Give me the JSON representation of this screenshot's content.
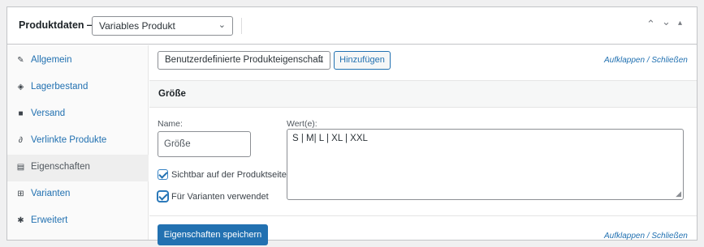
{
  "header": {
    "title": "Produktdaten —",
    "product_type": "Variables Produkt",
    "controls": [
      "⌃",
      "⌄",
      "▴"
    ]
  },
  "sidebar": {
    "items": [
      {
        "label": "Allgemein",
        "icon": "wrench-icon",
        "glyph": "✎"
      },
      {
        "label": "Lagerbestand",
        "icon": "tag-icon",
        "glyph": "◈"
      },
      {
        "label": "Versand",
        "icon": "truck-icon",
        "glyph": "■"
      },
      {
        "label": "Verlinkte Produkte",
        "icon": "link-icon",
        "glyph": "∂"
      },
      {
        "label": "Eigenschaften",
        "icon": "list-icon",
        "glyph": "▤"
      },
      {
        "label": "Varianten",
        "icon": "grid-icon",
        "glyph": "⊞"
      },
      {
        "label": "Erweitert",
        "icon": "gear-icon",
        "glyph": "✱"
      }
    ],
    "active_index": 4
  },
  "toolbar": {
    "attribute_select": "Benutzerdefinierte Produkteigenschaft",
    "add_label": "Hinzufügen",
    "expand_collapse": "Aufklappen / Schließen"
  },
  "attribute": {
    "heading": "Größe",
    "name_label": "Name:",
    "name_value": "Größe",
    "values_label": "Wert(e):",
    "values_value": "S | M| L | XL | XXL",
    "visible_label": "Sichtbar auf der Produktseite",
    "variations_label": "Für Varianten verwendet"
  },
  "footer": {
    "save_label": "Eigenschaften speichern",
    "expand_collapse": "Aufklappen / Schließen"
  },
  "colors": {
    "accent": "#2271b1",
    "border": "#c3c4c7",
    "background": "#f0f0f1"
  }
}
